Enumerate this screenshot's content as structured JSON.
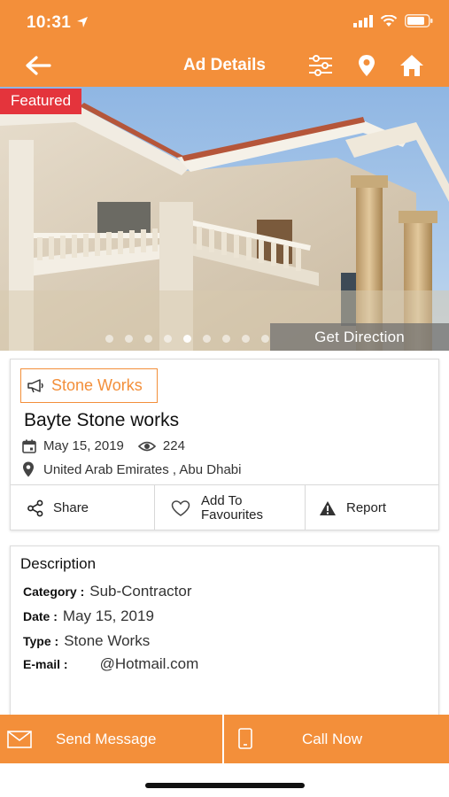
{
  "status_bar": {
    "time": "10:31"
  },
  "navbar": {
    "title": "Ad Details"
  },
  "hero": {
    "badge": "Featured",
    "get_direction": "Get Direction",
    "slide_count": 9,
    "active_slide": 4
  },
  "ad": {
    "category_chip": "Stone Works",
    "title": "Bayte Stone works",
    "date": "May 15, 2019",
    "views": "224",
    "location": "United Arab Emirates , Abu Dhabi"
  },
  "actions": {
    "share": "Share",
    "favourite_line1": "Add To",
    "favourite_line2": "Favourites",
    "report": "Report"
  },
  "description": {
    "heading": "Description",
    "category_label": "Category :",
    "category_value": "Sub-Contractor",
    "date_label": "Date :",
    "date_value": "May 15, 2019",
    "type_label": "Type :",
    "type_value": "Stone Works",
    "email_label": "E-mail :",
    "email_value": "@Hotmail.com"
  },
  "bottom_bar": {
    "send_message": "Send Message",
    "call_now": "Call Now"
  },
  "colors": {
    "accent": "#f38f3a",
    "featured_badge": "#e4343c"
  },
  "icons": [
    "back-arrow-icon",
    "filter-sliders-icon",
    "location-pin-icon",
    "home-icon",
    "megaphone-icon",
    "calendar-icon",
    "eye-icon",
    "share-icon",
    "heart-icon",
    "warning-icon",
    "envelope-icon",
    "phone-icon"
  ]
}
